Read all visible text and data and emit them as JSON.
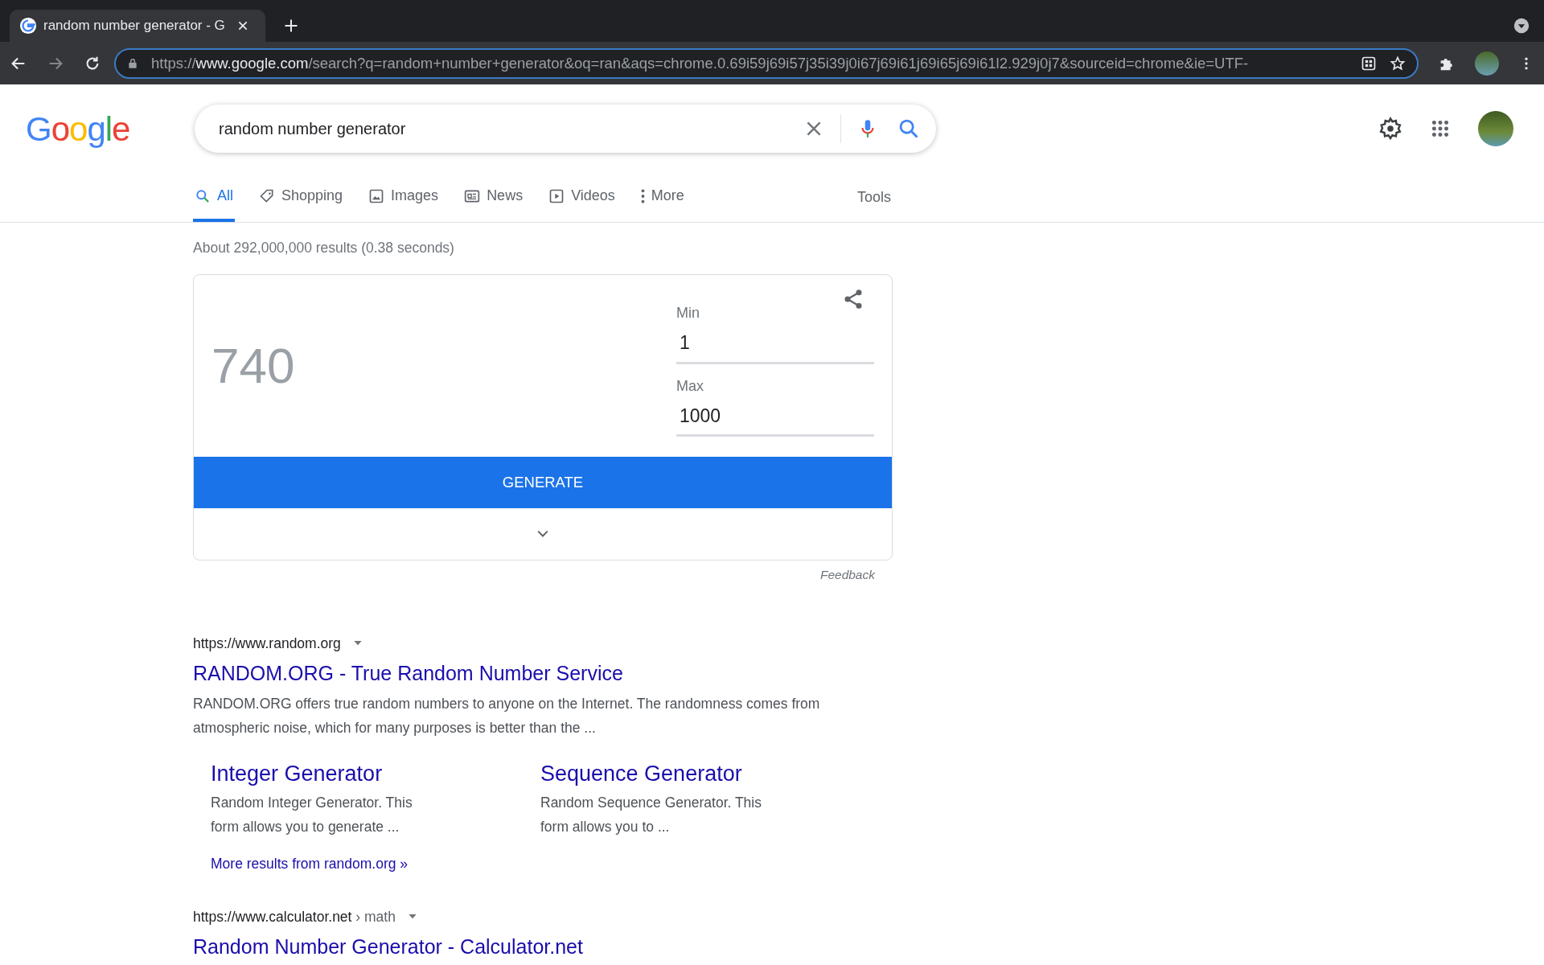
{
  "browser": {
    "tab": {
      "title": "random number generator - G"
    },
    "url": {
      "scheme": "https://",
      "host": "www.google.com",
      "rest": "/search?q=random+number+generator&oq=ran&aqs=chrome.0.69i59j69i57j35i39j0i67j69i61j69i65j69i61l2.929j0j7&sourceid=chrome&ie=UTF-"
    }
  },
  "header": {
    "logo": [
      {
        "letter": "G",
        "color": "#4285f4"
      },
      {
        "letter": "o",
        "color": "#ea4335"
      },
      {
        "letter": "o",
        "color": "#fbbc05"
      },
      {
        "letter": "g",
        "color": "#4285f4"
      },
      {
        "letter": "l",
        "color": "#34a853"
      },
      {
        "letter": "e",
        "color": "#ea4335"
      }
    ],
    "search": {
      "value": "random number generator"
    }
  },
  "nav": {
    "tabs": [
      {
        "label": "All",
        "kind": "search",
        "selected": true
      },
      {
        "label": "Shopping",
        "kind": "tag",
        "selected": false
      },
      {
        "label": "Images",
        "kind": "image",
        "selected": false
      },
      {
        "label": "News",
        "kind": "news",
        "selected": false
      },
      {
        "label": "Videos",
        "kind": "video",
        "selected": false
      },
      {
        "label": "More",
        "kind": "dots",
        "selected": false
      }
    ],
    "tools": "Tools"
  },
  "stats": "About 292,000,000 results (0.38 seconds)",
  "rng": {
    "result": "740",
    "min": {
      "label": "Min",
      "value": "1"
    },
    "max": {
      "label": "Max",
      "value": "1000"
    },
    "button": "GENERATE",
    "feedback": "Feedback"
  },
  "results": [
    {
      "url": "https://www.random.org",
      "title": "RANDOM.ORG - True Random Number Service",
      "snippet": "RANDOM.ORG offers true random numbers to anyone on the Internet. The randomness comes from atmospheric noise, which for many purposes is better than the ...",
      "sitelinks": [
        {
          "title": "Integer Generator",
          "text": "Random Integer Generator. This form allows you to generate ..."
        },
        {
          "title": "Sequence Generator",
          "text": "Random Sequence Generator. This form allows you to ..."
        }
      ],
      "more": "More results from random.org »"
    },
    {
      "url": "https://www.calculator.net",
      "path": "› math",
      "title": "Random Number Generator - Calculator.net"
    }
  ]
}
